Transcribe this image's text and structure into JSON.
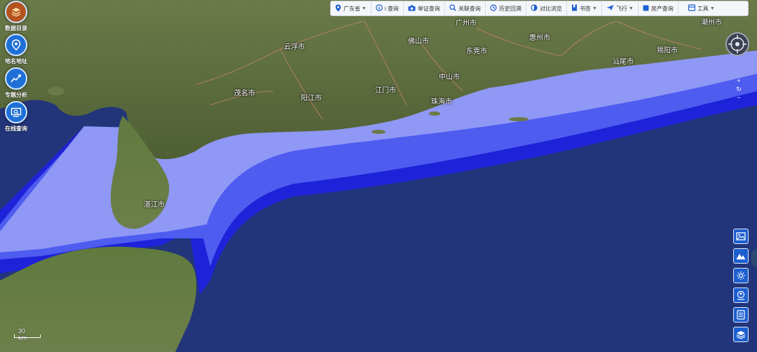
{
  "left_menu": [
    {
      "label": "数据目录",
      "icon": "layers-icon"
    },
    {
      "label": "地名地址",
      "icon": "location-pin-icon"
    },
    {
      "label": "专题分析",
      "icon": "trend-chart-icon"
    },
    {
      "label": "在线查询",
      "icon": "search-monitor-icon"
    }
  ],
  "toolbar": {
    "province": "广东省",
    "i_query": "i 查询",
    "evidence_query": "举证查询",
    "related_query": "关联查询",
    "history": "历史回溯",
    "compare": "对比浏览",
    "bookmark": "书签",
    "fly": "飞行",
    "property_query": "房产查询",
    "tools": "工具"
  },
  "cities": [
    {
      "name": "广州市"
    },
    {
      "name": "佛山市"
    },
    {
      "name": "惠州市"
    },
    {
      "name": "潮州市"
    },
    {
      "name": "云浮市"
    },
    {
      "name": "东莞市"
    },
    {
      "name": "揭阳市"
    },
    {
      "name": "中山市"
    },
    {
      "name": "汕尾市"
    },
    {
      "name": "茂名市"
    },
    {
      "name": "阳江市"
    },
    {
      "name": "江门市"
    },
    {
      "name": "珠海市"
    },
    {
      "name": "湛江市"
    }
  ],
  "zoom": {
    "in": "+",
    "reset": "↻",
    "out": "−"
  },
  "right_tools": [
    {
      "icon": "image-icon"
    },
    {
      "icon": "terrain-icon"
    },
    {
      "icon": "sun-icon"
    },
    {
      "icon": "globe-person-icon"
    },
    {
      "icon": "list-icon"
    },
    {
      "icon": "layers-icon"
    }
  ],
  "scale_label": "30 km",
  "colors": {
    "sea_deep": "#22357a",
    "depth_shallow": "#8f98f5",
    "depth_mid": "#4e5cf0",
    "depth_deep": "#1e22d8",
    "land": "#5a6a3c",
    "toolbar_bg": "#f4f6fa",
    "tool_button": "#1d5fd1"
  }
}
